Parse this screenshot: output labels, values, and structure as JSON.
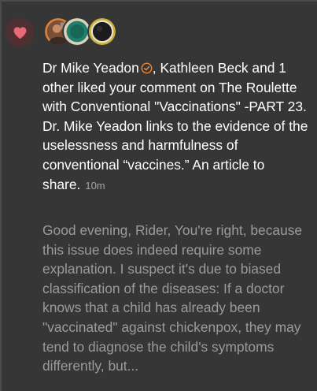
{
  "notification": {
    "icon": "heart-icon",
    "badge_color": "#502f32",
    "heart_color": "#e96a76",
    "avatars": [
      {
        "name": "avatar-photo",
        "ring_color": "#d9823a"
      },
      {
        "name": "avatar-green",
        "ring_color": "#1f7f6c"
      },
      {
        "name": "avatar-dark",
        "ring_color": "#c9b037"
      }
    ],
    "actor_name": "Dr Mike Yeadon",
    "verified_icon": "verified-check-icon",
    "headline_rest": ", Kathleen Beck and 1 other liked your comment on The Roulette with Conventional \"Vaccinations\" -PART 23. Dr. Mike Yeadon links to the evidence of the uselessness and harmfulness of conventional “vaccines.” An article to share.",
    "time": "10m",
    "excerpt": "Good evening, Rider, You're right, be­cause this issue does indeed require some explanation. I suspect it's due to biased classification of the diseases: If a doctor knows that a child has already been \"vaccinated\" against chickenpox, they may tend to diagnose the child's symptoms differently, but..."
  }
}
